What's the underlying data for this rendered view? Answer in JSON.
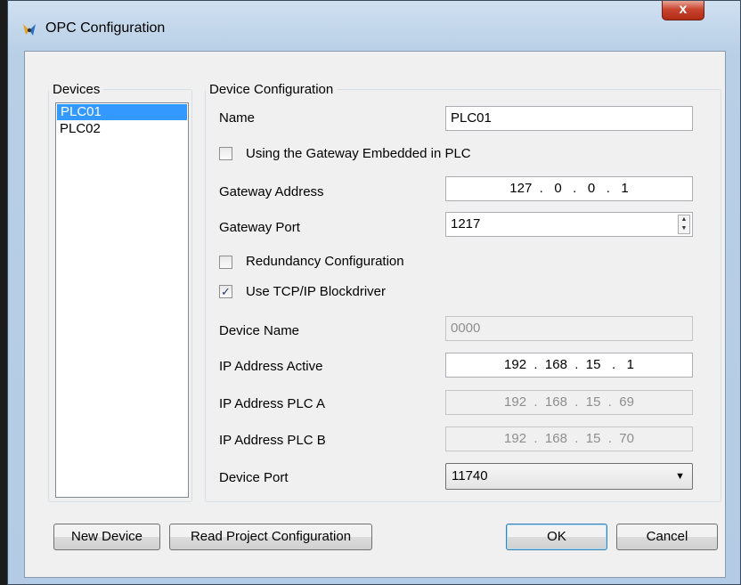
{
  "window": {
    "title": "OPC Configuration",
    "close_label": "x"
  },
  "devices": {
    "legend": "Devices",
    "items": [
      {
        "label": "PLC01",
        "selected": true
      },
      {
        "label": "PLC02",
        "selected": false
      }
    ]
  },
  "config": {
    "legend": "Device Configuration",
    "name_label": "Name",
    "name_value": "PLC01",
    "gateway_embedded_label": "Using the Gateway Embedded in PLC",
    "gateway_embedded_checked": false,
    "gateway_address_label": "Gateway Address",
    "gateway_address_value": "127  .   0   .   0   .   1",
    "gateway_port_label": "Gateway Port",
    "gateway_port_value": "1217",
    "redundancy_label": "Redundancy Configuration",
    "redundancy_checked": false,
    "tcpip_label": "Use TCP/IP Blockdriver",
    "tcpip_checked": true,
    "tcpip_check_glyph": "✓",
    "device_name_label": "Device Name",
    "device_name_value": "0000",
    "ip_active_label": "IP Address Active",
    "ip_active_value": "192  .  168  .  15   .   1",
    "ip_plc_a_label": "IP Address PLC A",
    "ip_plc_a_value": "192  .  168  .  15  .  69",
    "ip_plc_b_label": "IP Address PLC B",
    "ip_plc_b_value": "192  .  168  .  15  .  70",
    "device_port_label": "Device Port",
    "device_port_value": "11740"
  },
  "buttons": {
    "new_device": "New Device",
    "read_project": "Read Project Configuration",
    "ok": "OK",
    "cancel": "Cancel"
  },
  "colors": {
    "selection": "#3399ff",
    "close_button": "#c9452f"
  }
}
